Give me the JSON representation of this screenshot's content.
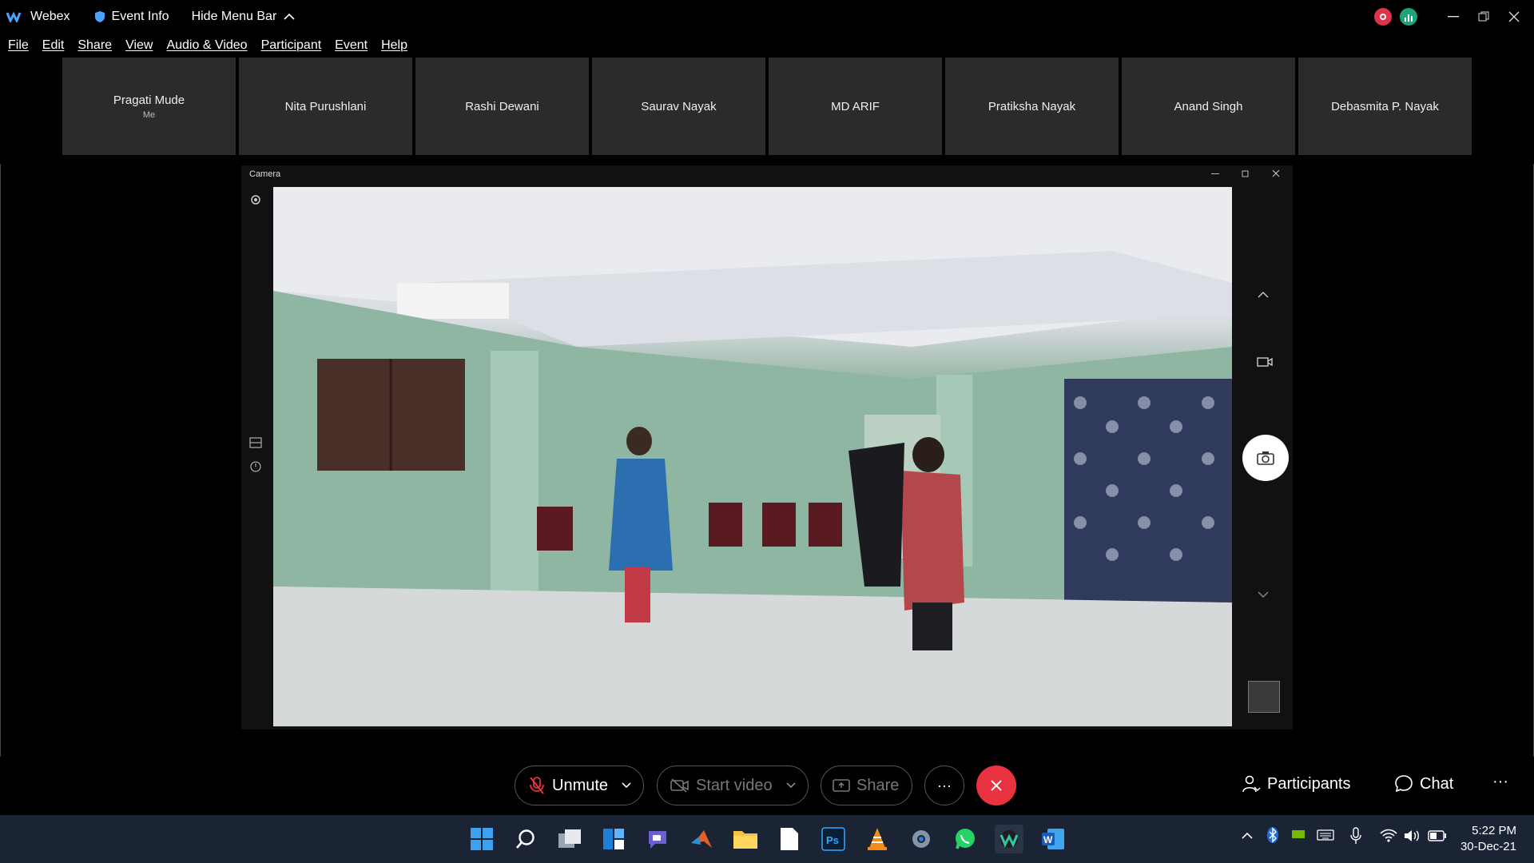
{
  "titlebar": {
    "app_name": "Webex",
    "event_info": "Event Info",
    "hide_menu": "Hide Menu Bar"
  },
  "menu": [
    "File",
    "Edit",
    "Share",
    "View",
    "Audio & Video",
    "Participant",
    "Event",
    "Help"
  ],
  "participants": [
    {
      "name": "Pragati Mude",
      "sub": "Me"
    },
    {
      "name": "Nita Purushlani",
      "sub": ""
    },
    {
      "name": "Rashi Dewani",
      "sub": ""
    },
    {
      "name": "Saurav Nayak",
      "sub": ""
    },
    {
      "name": "MD ARIF",
      "sub": ""
    },
    {
      "name": "Pratiksha Nayak",
      "sub": ""
    },
    {
      "name": "Anand Singh",
      "sub": ""
    },
    {
      "name": "Debasmita P. Nayak",
      "sub": ""
    }
  ],
  "camera_window": {
    "title": "Camera"
  },
  "controls": {
    "unmute": "Unmute",
    "start_video": "Start video",
    "share": "Share",
    "more": "···",
    "participants": "Participants",
    "chat": "Chat",
    "overflow": "···"
  },
  "taskbar": {
    "time": "5:22 PM",
    "date": "30-Dec-21"
  },
  "colors": {
    "end_call": "#e8323f",
    "taskbar_bg": "#1b2435",
    "tile_bg": "#2b2b2b"
  }
}
